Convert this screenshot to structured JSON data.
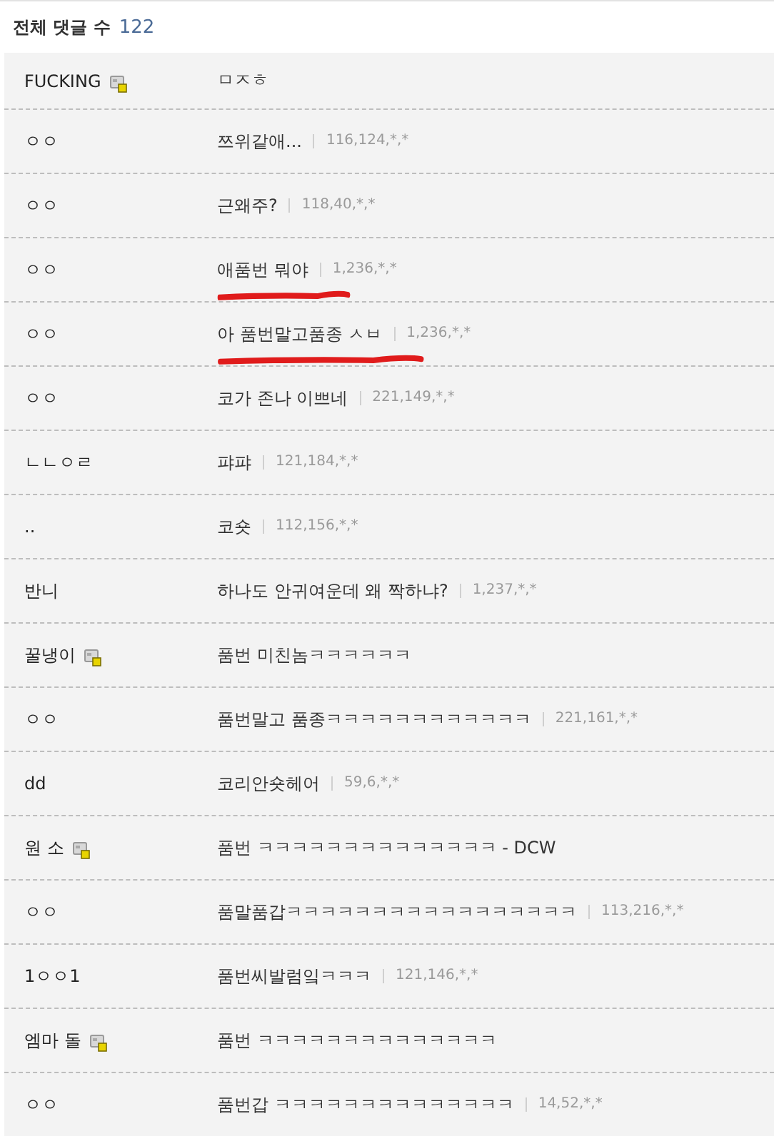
{
  "header": {
    "label": "전체 댓글 수",
    "count": "122"
  },
  "comments": [
    {
      "name": "FUCKING",
      "member_icon": true,
      "text": "ㅁㅈㅎ",
      "underlined": false
    },
    {
      "name": "ㅇㅇ",
      "member_icon": false,
      "text": "쯔위같애...",
      "ip": "116,124,*,*",
      "underlined": false
    },
    {
      "name": "ㅇㅇ",
      "member_icon": false,
      "text": "근왜주?",
      "ip": "118,40,*,*",
      "underlined": false
    },
    {
      "name": "ㅇㅇ",
      "member_icon": false,
      "text": "애품번 뭐야",
      "ip": "1,236,*,*",
      "underlined": true
    },
    {
      "name": "ㅇㅇ",
      "member_icon": false,
      "text": "아 품번말고품종 ㅅㅂ",
      "ip": "1,236,*,*",
      "underlined": true
    },
    {
      "name": "ㅇㅇ",
      "member_icon": false,
      "text": "코가 존나 이쁘네",
      "ip": "221,149,*,*",
      "underlined": false
    },
    {
      "name": "ㄴㄴㅇㄹ",
      "member_icon": false,
      "text": "퍄퍄",
      "ip": "121,184,*,*",
      "underlined": false
    },
    {
      "name": "..",
      "member_icon": false,
      "text": "코숏",
      "ip": "112,156,*,*",
      "underlined": false
    },
    {
      "name": "반니",
      "member_icon": false,
      "text": "하나도 안귀여운데 왜 짝하냐?",
      "ip": "1,237,*,*",
      "underlined": false
    },
    {
      "name": "꿀냉이",
      "member_icon": true,
      "text": "품번 미친놈ㅋㅋㅋㅋㅋㅋ",
      "underlined": false
    },
    {
      "name": "ㅇㅇ",
      "member_icon": false,
      "text": "품번말고 품종ㅋㅋㅋㅋㅋㅋㅋㅋㅋㅋㅋㅋ",
      "ip": "221,161,*,*",
      "underlined": false
    },
    {
      "name": "dd",
      "member_icon": false,
      "text": "코리안숏헤어",
      "ip": "59,6,*,*",
      "underlined": false
    },
    {
      "name": "원 소",
      "member_icon": true,
      "text": "품번 ㅋㅋㅋㅋㅋㅋㅋㅋㅋㅋㅋㅋㅋㅋ - DCW",
      "underlined": false
    },
    {
      "name": "ㅇㅇ",
      "member_icon": false,
      "text": "품말품갑ㅋㅋㅋㅋㅋㅋㅋㅋㅋㅋㅋㅋㅋㅋㅋㅋㅋ",
      "ip": "113,216,*,*",
      "underlined": false
    },
    {
      "name": "1ㅇㅇ1",
      "member_icon": false,
      "text": "품번씨발럼잌ㅋㅋㅋ",
      "ip": "121,146,*,*",
      "underlined": false
    },
    {
      "name": "엠마 돌",
      "member_icon": true,
      "text": "품번 ㅋㅋㅋㅋㅋㅋㅋㅋㅋㅋㅋㅋㅋㅋ",
      "underlined": false
    },
    {
      "name": "ㅇㅇ",
      "member_icon": false,
      "text": "품번갑 ㅋㅋㅋㅋㅋㅋㅋㅋㅋㅋㅋㅋㅋㅋ",
      "ip": "14,52,*,*",
      "underlined": false
    }
  ]
}
